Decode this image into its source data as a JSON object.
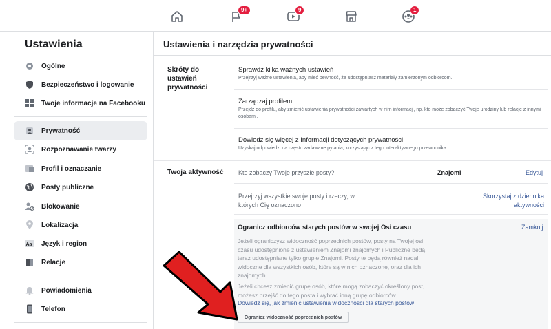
{
  "topnav": {
    "items": [
      {
        "icon": "home-icon",
        "badge": ""
      },
      {
        "icon": "flag-icon",
        "badge": "9+"
      },
      {
        "icon": "watch-icon",
        "badge": "9"
      },
      {
        "icon": "marketplace-icon",
        "badge": ""
      },
      {
        "icon": "groups-icon",
        "badge": "1"
      }
    ]
  },
  "sidebar": {
    "title": "Ustawienia",
    "items": [
      {
        "label": "Ogólne",
        "icon": "gear-icon"
      },
      {
        "label": "Bezpieczeństwo i logowanie",
        "icon": "shield-icon"
      },
      {
        "label": "Twoje informacje na Facebooku",
        "icon": "grid-icon"
      },
      {
        "label": "Prywatność",
        "icon": "lock-person-icon"
      },
      {
        "label": "Rozpoznawanie twarzy",
        "icon": "face-icon"
      },
      {
        "label": "Profil i oznaczanie",
        "icon": "tag-icon"
      },
      {
        "label": "Posty publiczne",
        "icon": "globe-icon"
      },
      {
        "label": "Blokowanie",
        "icon": "block-user-icon"
      },
      {
        "label": "Lokalizacja",
        "icon": "location-pin-icon"
      },
      {
        "label": "Język i region",
        "icon": "language-icon"
      },
      {
        "label": "Relacje",
        "icon": "book-icon"
      },
      {
        "label": "Powiadomienia",
        "icon": "bell-icon"
      },
      {
        "label": "Telefon",
        "icon": "phone-icon"
      }
    ]
  },
  "main": {
    "title": "Ustawienia i narzędzia prywatności",
    "shortcuts": {
      "label": "Skróty do ustawień prywatności",
      "rows": [
        {
          "title": "Sprawdź kilka ważnych ustawień",
          "desc": "Przejrzyj ważne ustawienia, aby mieć pewność, że udostępniasz materiały zamierzonym odbiorcom."
        },
        {
          "title": "Zarządzaj profilem",
          "desc": "Przejdź do profilu, aby zmienić ustawienia prywatności zawartych w nim informacji, np. kto może zobaczyć Twoje urodziny lub relacje z innymi osobami."
        },
        {
          "title": "Dowiedz się więcej z Informacji dotyczących prywatności",
          "desc": "Uzyskaj odpowiedzi na często zadawane pytania, korzystając z tego interaktywnego przewodnika."
        }
      ]
    },
    "activity": {
      "label": "Twoja aktywność",
      "future_posts_question": "Kto zobaczy Twoje przyszłe posty?",
      "future_posts_value": "Znajomi",
      "edit_link": "Edytuj",
      "review_text": "Przejrzyj wszystkie swoje posty i rzeczy, w których Cię oznaczono",
      "activity_log_link": "Skorzystaj z dziennika aktywności",
      "limit_panel": {
        "title": "Ogranicz odbiorców starych postów w swojej Osi czasu",
        "close": "Zamknij",
        "para1": "Jeżeli ograniczysz widoczność poprzednich postów, posty na Twojej osi czasu udostępnione z ustawieniem Znajomi znajomych i Publiczne będą teraz udostępniane tylko grupie Znajomi. Posty te będą również nadal widoczne dla wszystkich osób, które są w nich oznaczone, oraz dla ich znajomych.",
        "para2": "Jeżeli chcesz zmienić grupę osób, które mogą zobaczyć określony post, możesz przejść do tego posta i wybrać inną grupę odbiorców.",
        "learn_link": "Dowiedz się, jak zmienić ustawienia widoczności dla starych postów",
        "button": "Ogranicz widoczność poprzednich postów"
      }
    }
  },
  "colors": {
    "accent": "#385898",
    "badge": "#e41e3f",
    "arrow": "#e02020",
    "active_bg": "#ebedf0"
  }
}
